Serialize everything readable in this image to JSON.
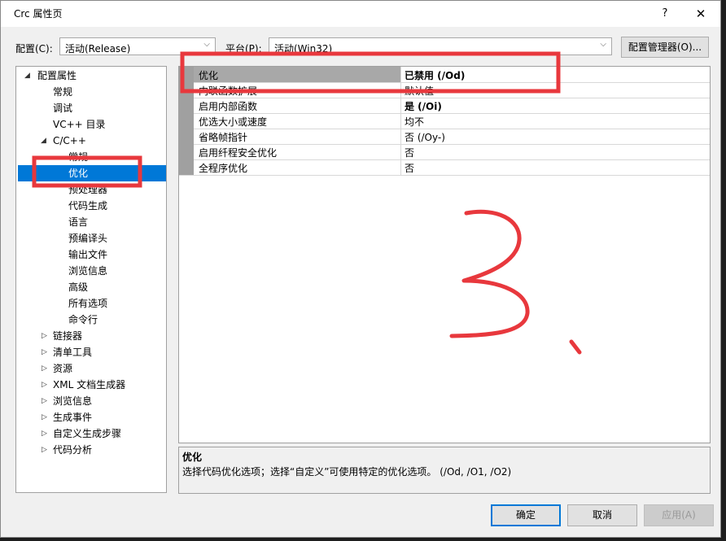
{
  "window": {
    "title": "Crc 属性页",
    "help": "?",
    "close": "✕"
  },
  "config_bar": {
    "config_label": "配置(C):",
    "config_value": "活动(Release)",
    "platform_label": "平台(P):",
    "platform_value": "活动(Win32)",
    "manager_button": "配置管理器(O)..."
  },
  "tree": {
    "items": [
      {
        "label": "配置属性",
        "arrow": "◢"
      },
      {
        "label": "常规"
      },
      {
        "label": "调试"
      },
      {
        "label": "VC++ 目录"
      },
      {
        "label": "C/C++",
        "arrow": "◢"
      },
      {
        "label": "常规"
      },
      {
        "label": "优化"
      },
      {
        "label": "预处理器"
      },
      {
        "label": "代码生成"
      },
      {
        "label": "语言"
      },
      {
        "label": "预编译头"
      },
      {
        "label": "输出文件"
      },
      {
        "label": "浏览信息"
      },
      {
        "label": "高级"
      },
      {
        "label": "所有选项"
      },
      {
        "label": "命令行"
      },
      {
        "label": "链接器",
        "arrow": "▷"
      },
      {
        "label": "清单工具",
        "arrow": "▷"
      },
      {
        "label": "资源",
        "arrow": "▷"
      },
      {
        "label": "XML 文档生成器",
        "arrow": "▷"
      },
      {
        "label": "浏览信息",
        "arrow": "▷"
      },
      {
        "label": "生成事件",
        "arrow": "▷"
      },
      {
        "label": "自定义生成步骤",
        "arrow": "▷"
      },
      {
        "label": "代码分析",
        "arrow": "▷"
      }
    ]
  },
  "grid": {
    "rows": [
      {
        "name": "优化",
        "value": "已禁用 (/Od)"
      },
      {
        "name": "内联函数扩展",
        "value": "默认值"
      },
      {
        "name": "启用内部函数",
        "value": "是 (/Oi)"
      },
      {
        "name": "优选大小或速度",
        "value": "均不"
      },
      {
        "name": "省略帧指针",
        "value": "否 (/Oy-)"
      },
      {
        "name": "启用纤程安全优化",
        "value": "否"
      },
      {
        "name": "全程序优化",
        "value": "否"
      }
    ]
  },
  "description": {
    "title": "优化",
    "text": "选择代码优化选项；选择“自定义”可使用特定的优化选项。     (/Od, /O1, /O2)"
  },
  "buttons": {
    "ok": "确定",
    "cancel": "取消",
    "apply": "应用(A)"
  },
  "annotations": {
    "highlight_color": "#e8383d",
    "handwritten": "3."
  }
}
